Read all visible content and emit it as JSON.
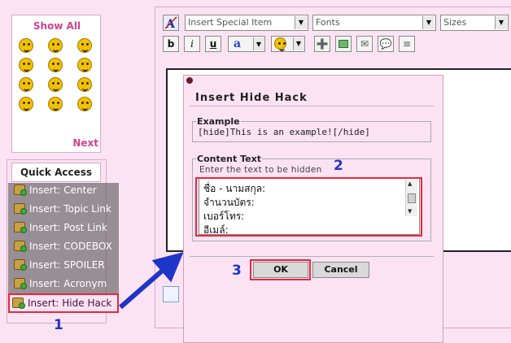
{
  "smileys": {
    "show_all_label": "Show All",
    "next_label": "Next",
    "icons": [
      "grin-smiley-icon",
      "sad-smiley-icon",
      "neutral-smiley-icon",
      "surprised-smiley-icon",
      "angry-smiley-icon",
      "confused-smiley-icon",
      "shocked-smiley-icon",
      "laugh-smiley-icon",
      "wink-smiley-icon",
      "eek-smiley-icon",
      "tongue-smiley-icon",
      "sick-smiley-icon"
    ]
  },
  "quick_access": {
    "title": "Quick Access",
    "items": [
      {
        "label": "Insert: Center"
      },
      {
        "label": "Insert: Topic Link"
      },
      {
        "label": "Insert: Post Link"
      },
      {
        "label": "Insert: CODEBOX"
      },
      {
        "label": "Insert: SPOILER"
      },
      {
        "label": "Insert: Acronym"
      },
      {
        "label": "Insert: Hide Hack"
      }
    ]
  },
  "toolbar": {
    "special_item": "Insert Special Item",
    "fonts": "Fonts",
    "sizes": "Sizes",
    "bold": "b",
    "italic": "i",
    "underline": "u",
    "font_color": "a"
  },
  "dialog": {
    "title": "Insert Hide Hack",
    "example_legend": "Example",
    "example_text": "[hide]This is an example![/hide]",
    "content_legend": "Content Text",
    "content_hint": "Enter the text to be hidden",
    "content_lines": [
      "ชื่อ - นามสกุล:",
      "จำนวนบัตร:",
      "เบอร์โทร:",
      "อีเมล์:"
    ],
    "ok_label": "OK",
    "cancel_label": "Cancel"
  },
  "annotations": {
    "step1": "1",
    "step2": "2",
    "step3": "3"
  },
  "colors": {
    "accent": "#d0428f",
    "highlight": "#e6283c",
    "annotation": "#1f35c9",
    "background": "#fbe3f3"
  }
}
